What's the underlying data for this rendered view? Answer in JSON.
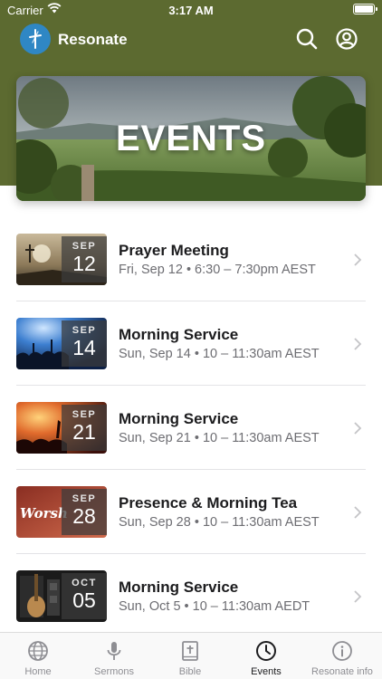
{
  "status_bar": {
    "carrier": "Carrier",
    "time": "3:17 AM"
  },
  "header": {
    "app_title": "Resonate",
    "hero_title": "EVENTS",
    "colors": {
      "header_bg": "#5c6a30",
      "logo_bg": "#2f87c4"
    }
  },
  "events": [
    {
      "title": "Prayer Meeting",
      "subtitle": "Fri, Sep 12 • 6:30 – 7:30pm AEST",
      "month": "SEP",
      "day": "12",
      "thumb": "sky-cross"
    },
    {
      "title": "Morning Service",
      "subtitle": "Sun, Sep 14 • 10 – 11:30am AEST",
      "month": "SEP",
      "day": "14",
      "thumb": "blue-worship"
    },
    {
      "title": "Morning Service",
      "subtitle": "Sun, Sep 21 • 10 – 11:30am AEST",
      "month": "SEP",
      "day": "21",
      "thumb": "red-concert"
    },
    {
      "title": "Presence & Morning Tea",
      "subtitle": "Sun, Sep 28 • 10 – 11:30am AEST",
      "month": "SEP",
      "day": "28",
      "thumb": "worship-text",
      "thumb_text": "Worsh"
    },
    {
      "title": "Morning Service",
      "subtitle": "Sun, Oct 5 • 10 – 11:30am AEDT",
      "month": "OCT",
      "day": "05",
      "thumb": "guitars"
    }
  ],
  "tabs": [
    {
      "label": "Home",
      "icon": "globe-icon",
      "active": false
    },
    {
      "label": "Sermons",
      "icon": "microphone-icon",
      "active": false
    },
    {
      "label": "Bible",
      "icon": "bible-icon",
      "active": false
    },
    {
      "label": "Events",
      "icon": "clock-icon",
      "active": true
    },
    {
      "label": "Resonate info",
      "icon": "info-icon",
      "active": false
    }
  ]
}
